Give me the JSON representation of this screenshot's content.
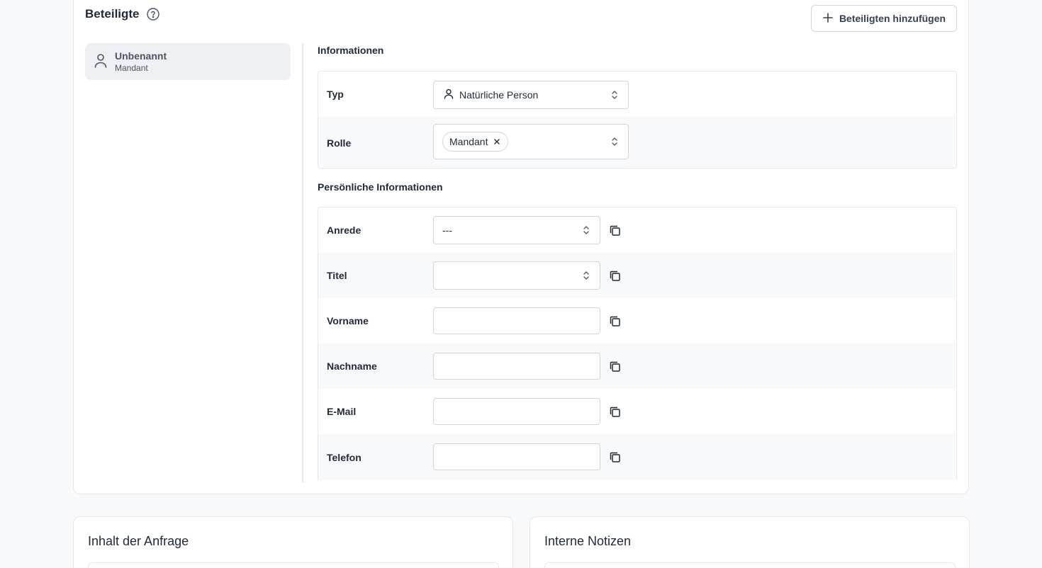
{
  "parties": {
    "title": "Beteiligte",
    "add_button_label": "Beteiligten hinzufügen",
    "list": [
      {
        "name": "Unbenannt",
        "role": "Mandant"
      }
    ]
  },
  "information": {
    "heading": "Informationen",
    "type_label": "Typ",
    "type_value": "Natürliche Person",
    "role_label": "Rolle",
    "role_chip": "Mandant"
  },
  "personal": {
    "heading": "Persönliche Informationen",
    "salutation_label": "Anrede",
    "salutation_value": "---",
    "title_label": "Titel",
    "title_value": "",
    "firstname_label": "Vorname",
    "firstname_value": "",
    "lastname_label": "Nachname",
    "lastname_value": "",
    "email_label": "E-Mail",
    "email_value": "",
    "phone_label": "Telefon",
    "phone_value": ""
  },
  "request_content": {
    "title": "Inhalt der Anfrage"
  },
  "internal_notes": {
    "title": "Interne Notizen"
  },
  "icons": {
    "help": "help-circle-icon",
    "add": "plus-icon",
    "person": "user-icon",
    "chevron": "chevron-up-down-icon",
    "remove": "x-icon",
    "copy": "copy-icon"
  }
}
